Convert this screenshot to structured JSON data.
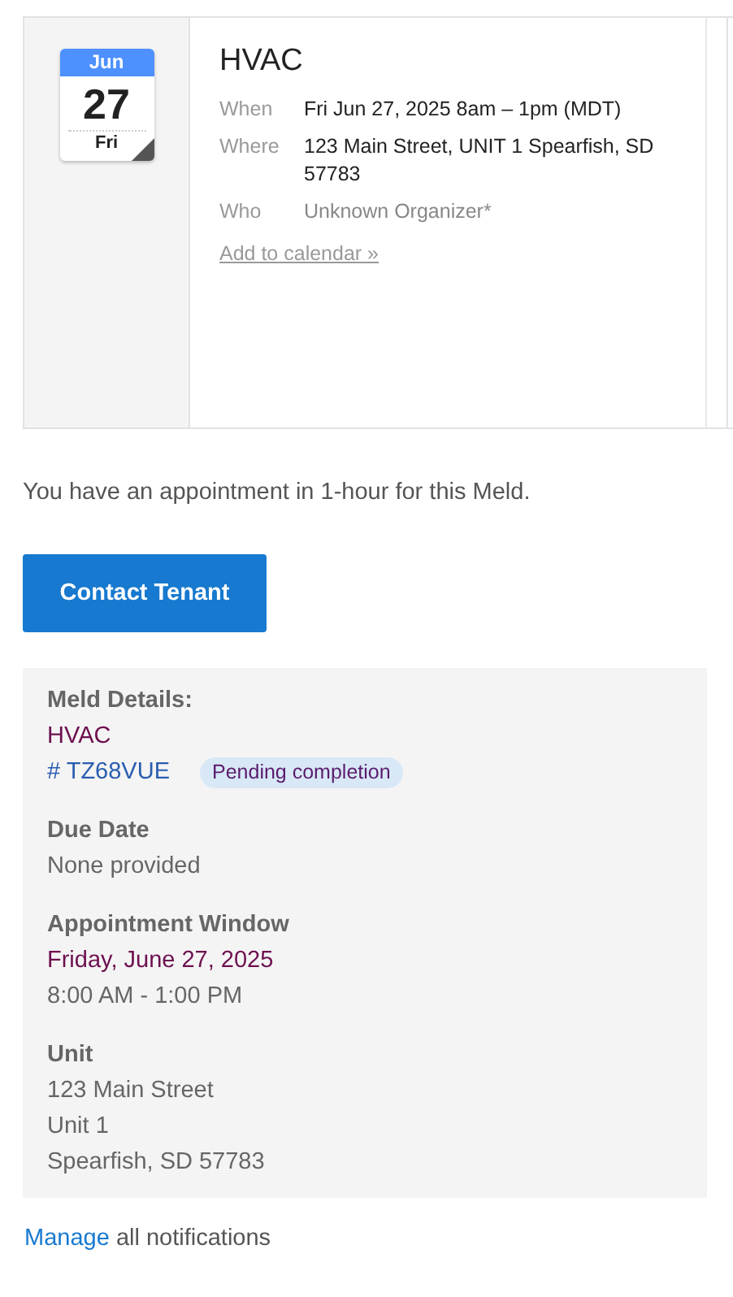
{
  "event": {
    "month": "Jun",
    "day": "27",
    "weekday": "Fri",
    "title": "HVAC",
    "rows": [
      {
        "label": "When",
        "value": "Fri Jun 27, 2025 8am – 1pm (MDT)",
        "muted": false
      },
      {
        "label": "Where",
        "value": "123 Main Street, UNIT 1 Spearfish, SD 57783",
        "muted": false
      },
      {
        "label": "Who",
        "value": "Unknown Organizer*",
        "muted": true
      }
    ],
    "add_link": "Add to calendar »"
  },
  "notice": "You have an appointment in 1-hour for this Meld.",
  "contact_button": "Contact Tenant",
  "details": {
    "heading": "Meld Details:",
    "category": "HVAC",
    "ref": "# TZ68VUE",
    "status": "Pending completion",
    "sections": [
      {
        "heading": "Due Date",
        "lines": [
          {
            "text": "None provided",
            "kind": "plain"
          }
        ]
      },
      {
        "heading": "Appointment Window",
        "lines": [
          {
            "text": "Friday, June 27, 2025",
            "kind": "date"
          },
          {
            "text": "8:00 AM - 1:00 PM",
            "kind": "plain"
          }
        ]
      },
      {
        "heading": "Unit",
        "lines": [
          {
            "text": "123 Main Street",
            "kind": "plain"
          },
          {
            "text": "Unit 1",
            "kind": "plain"
          },
          {
            "text": "Spearfish, SD 57783",
            "kind": "plain"
          }
        ]
      }
    ]
  },
  "footer": {
    "link": "Manage",
    "text": "all notifications"
  }
}
